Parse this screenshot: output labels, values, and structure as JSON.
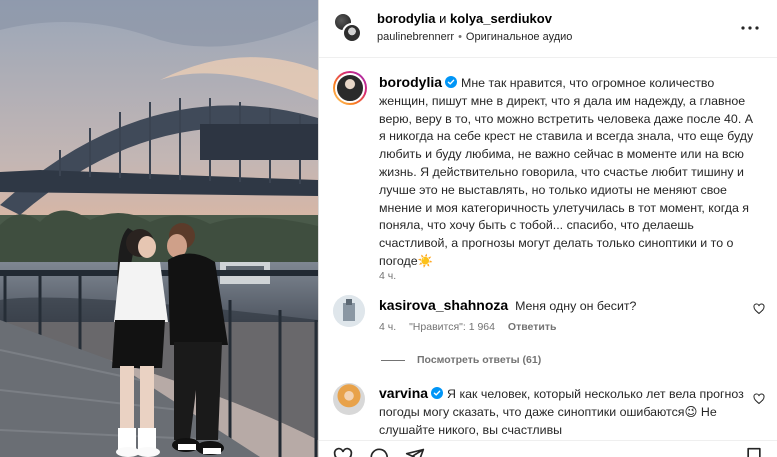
{
  "header": {
    "user1": "borodylia",
    "and_word": "и",
    "user2": "kolya_serdiukov",
    "audio_user": "paulinebrennerr",
    "separator": "•",
    "audio_label": "Оригинальное аудио"
  },
  "caption": {
    "username": "borodylia",
    "text": "Мне так нравится, что огромное количество женщин, пишут мне в директ, что я дала им надежду, а главное верю, веру в то, что можно встретить человека даже после 40. А я никогда на себе крест не ставила и всегда знала, что еще буду любить и буду любима, не важно сейчас в моменте или на всю жизнь. Я действительно говорила, что счастье любит тишину и лучше это не выставлять, но только идиоты не меняют свое мнение и моя категоричность улетучилась в тот момент, когда я поняла, что хочу быть с тобой... спасибо, что делаешь счастливой, а прогнозы могут делать только синоптики и то о погоде",
    "emoji": "☀️",
    "time": "4 ч."
  },
  "comments": [
    {
      "username": "kasirova_shahnoza",
      "text": "Меня одну он бесит?",
      "time": "4 ч.",
      "likes": "\"Нравится\": 1 964",
      "reply": "Ответить"
    },
    {
      "username": "varvina",
      "text": "Я как человек, который несколько лет вела прогноз погоды могу сказать, что даже синоптики ошибаются",
      "emoji": "😉",
      "text2": " Не слушайте никого, вы счастливы"
    }
  ],
  "view_replies": "Посмотреть ответы (61)",
  "colors": {
    "verified": "#0095f6",
    "secondary_text": "#737373",
    "border": "#dbdbdb"
  },
  "icons": [
    "more-icon",
    "verified-icon",
    "heart-icon",
    "comment-icon",
    "share-icon",
    "bookmark-icon"
  ]
}
